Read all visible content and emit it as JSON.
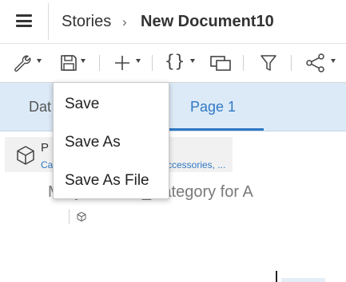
{
  "header": {
    "breadcrumb_root": "Stories",
    "breadcrumb_separator": "›",
    "document_title": "New Document10"
  },
  "toolbar": {
    "items": [
      "wrench-icon",
      "save-icon",
      "add-icon",
      "formula-icon",
      "copy-icon",
      "filter-icon",
      "share-icon"
    ]
  },
  "tabs": {
    "data_label": "Dat",
    "page1_label": "Page 1"
  },
  "save_menu": {
    "items": [
      "Save",
      "Save As",
      "Save As File"
    ]
  },
  "canvas": {
    "card_title": "P",
    "card_subtitle_left": "Ca",
    "card_subtitle_right": "ccessories, ...",
    "viz_title": "M          by Product_Category for A"
  },
  "colors": {
    "accent": "#2f78c4",
    "tabstrip_bg": "#dceaf7"
  }
}
